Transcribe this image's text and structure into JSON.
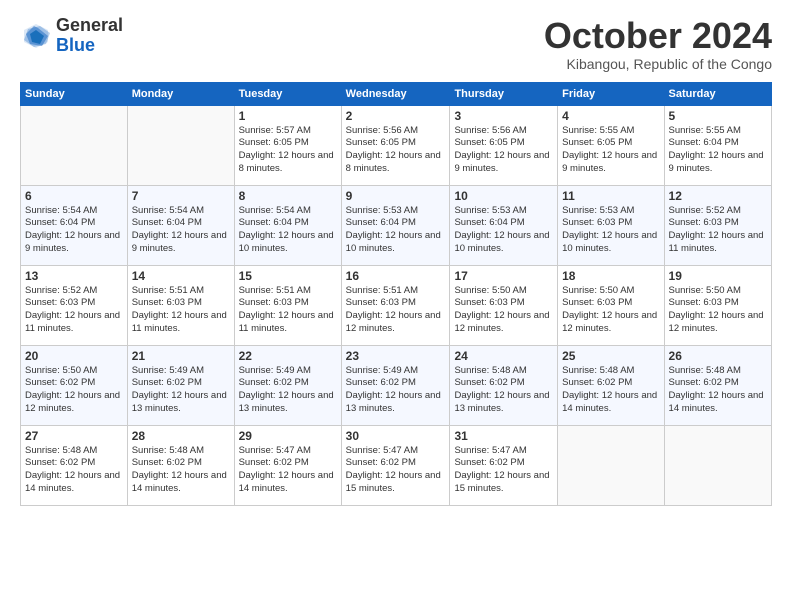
{
  "logo": {
    "general": "General",
    "blue": "Blue"
  },
  "title": "October 2024",
  "location": "Kibangou, Republic of the Congo",
  "days_header": [
    "Sunday",
    "Monday",
    "Tuesday",
    "Wednesday",
    "Thursday",
    "Friday",
    "Saturday"
  ],
  "weeks": [
    [
      {
        "day": "",
        "info": ""
      },
      {
        "day": "",
        "info": ""
      },
      {
        "day": "1",
        "info": "Sunrise: 5:57 AM\nSunset: 6:05 PM\nDaylight: 12 hours and 8 minutes."
      },
      {
        "day": "2",
        "info": "Sunrise: 5:56 AM\nSunset: 6:05 PM\nDaylight: 12 hours and 8 minutes."
      },
      {
        "day": "3",
        "info": "Sunrise: 5:56 AM\nSunset: 6:05 PM\nDaylight: 12 hours and 9 minutes."
      },
      {
        "day": "4",
        "info": "Sunrise: 5:55 AM\nSunset: 6:05 PM\nDaylight: 12 hours and 9 minutes."
      },
      {
        "day": "5",
        "info": "Sunrise: 5:55 AM\nSunset: 6:04 PM\nDaylight: 12 hours and 9 minutes."
      }
    ],
    [
      {
        "day": "6",
        "info": "Sunrise: 5:54 AM\nSunset: 6:04 PM\nDaylight: 12 hours and 9 minutes."
      },
      {
        "day": "7",
        "info": "Sunrise: 5:54 AM\nSunset: 6:04 PM\nDaylight: 12 hours and 9 minutes."
      },
      {
        "day": "8",
        "info": "Sunrise: 5:54 AM\nSunset: 6:04 PM\nDaylight: 12 hours and 10 minutes."
      },
      {
        "day": "9",
        "info": "Sunrise: 5:53 AM\nSunset: 6:04 PM\nDaylight: 12 hours and 10 minutes."
      },
      {
        "day": "10",
        "info": "Sunrise: 5:53 AM\nSunset: 6:04 PM\nDaylight: 12 hours and 10 minutes."
      },
      {
        "day": "11",
        "info": "Sunrise: 5:53 AM\nSunset: 6:03 PM\nDaylight: 12 hours and 10 minutes."
      },
      {
        "day": "12",
        "info": "Sunrise: 5:52 AM\nSunset: 6:03 PM\nDaylight: 12 hours and 11 minutes."
      }
    ],
    [
      {
        "day": "13",
        "info": "Sunrise: 5:52 AM\nSunset: 6:03 PM\nDaylight: 12 hours and 11 minutes."
      },
      {
        "day": "14",
        "info": "Sunrise: 5:51 AM\nSunset: 6:03 PM\nDaylight: 12 hours and 11 minutes."
      },
      {
        "day": "15",
        "info": "Sunrise: 5:51 AM\nSunset: 6:03 PM\nDaylight: 12 hours and 11 minutes."
      },
      {
        "day": "16",
        "info": "Sunrise: 5:51 AM\nSunset: 6:03 PM\nDaylight: 12 hours and 12 minutes."
      },
      {
        "day": "17",
        "info": "Sunrise: 5:50 AM\nSunset: 6:03 PM\nDaylight: 12 hours and 12 minutes."
      },
      {
        "day": "18",
        "info": "Sunrise: 5:50 AM\nSunset: 6:03 PM\nDaylight: 12 hours and 12 minutes."
      },
      {
        "day": "19",
        "info": "Sunrise: 5:50 AM\nSunset: 6:03 PM\nDaylight: 12 hours and 12 minutes."
      }
    ],
    [
      {
        "day": "20",
        "info": "Sunrise: 5:50 AM\nSunset: 6:02 PM\nDaylight: 12 hours and 12 minutes."
      },
      {
        "day": "21",
        "info": "Sunrise: 5:49 AM\nSunset: 6:02 PM\nDaylight: 12 hours and 13 minutes."
      },
      {
        "day": "22",
        "info": "Sunrise: 5:49 AM\nSunset: 6:02 PM\nDaylight: 12 hours and 13 minutes."
      },
      {
        "day": "23",
        "info": "Sunrise: 5:49 AM\nSunset: 6:02 PM\nDaylight: 12 hours and 13 minutes."
      },
      {
        "day": "24",
        "info": "Sunrise: 5:48 AM\nSunset: 6:02 PM\nDaylight: 12 hours and 13 minutes."
      },
      {
        "day": "25",
        "info": "Sunrise: 5:48 AM\nSunset: 6:02 PM\nDaylight: 12 hours and 14 minutes."
      },
      {
        "day": "26",
        "info": "Sunrise: 5:48 AM\nSunset: 6:02 PM\nDaylight: 12 hours and 14 minutes."
      }
    ],
    [
      {
        "day": "27",
        "info": "Sunrise: 5:48 AM\nSunset: 6:02 PM\nDaylight: 12 hours and 14 minutes."
      },
      {
        "day": "28",
        "info": "Sunrise: 5:48 AM\nSunset: 6:02 PM\nDaylight: 12 hours and 14 minutes."
      },
      {
        "day": "29",
        "info": "Sunrise: 5:47 AM\nSunset: 6:02 PM\nDaylight: 12 hours and 14 minutes."
      },
      {
        "day": "30",
        "info": "Sunrise: 5:47 AM\nSunset: 6:02 PM\nDaylight: 12 hours and 15 minutes."
      },
      {
        "day": "31",
        "info": "Sunrise: 5:47 AM\nSunset: 6:02 PM\nDaylight: 12 hours and 15 minutes."
      },
      {
        "day": "",
        "info": ""
      },
      {
        "day": "",
        "info": ""
      }
    ]
  ]
}
